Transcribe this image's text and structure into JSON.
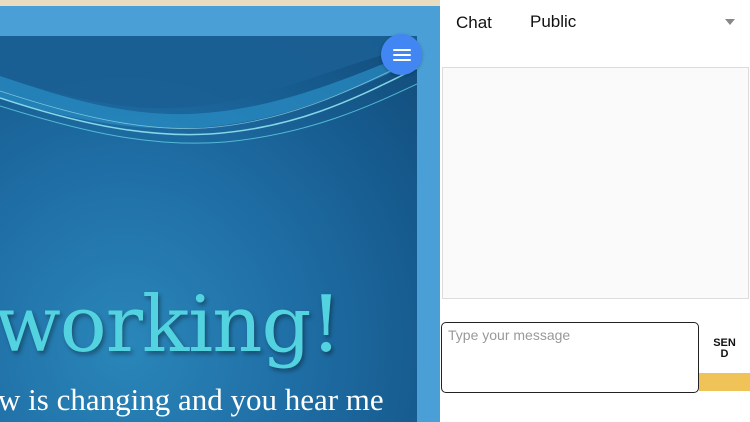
{
  "slide": {
    "title": "working!",
    "subtitle": "w is changing and you hear me"
  },
  "menu_button": {
    "icon": "menu-icon"
  },
  "chat": {
    "title": "Chat",
    "room": {
      "selected": "Public",
      "icon": "caret-down-icon"
    },
    "composer": {
      "placeholder": "Type your message",
      "value": ""
    },
    "send_label": "SEND"
  },
  "colors": {
    "pane_background": "#4a9fd6",
    "slide_title": "#53d3e0",
    "fab": "#4286f4",
    "send_accent": "#f0c358"
  }
}
